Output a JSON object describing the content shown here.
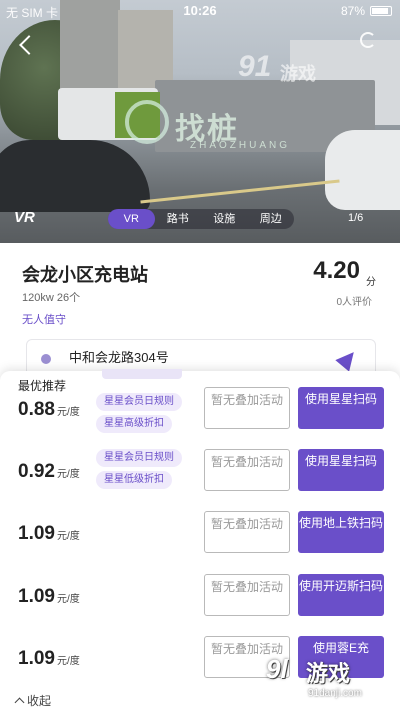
{
  "status_bar": {
    "carrier": "无 SIM 卡",
    "time": "10:26",
    "battery": "87%"
  },
  "hero": {
    "vr_logo": "VR",
    "tabs": [
      {
        "label": "VR",
        "active": true
      },
      {
        "label": "路书",
        "active": false
      },
      {
        "label": "设施",
        "active": false
      },
      {
        "label": "周边",
        "active": false
      }
    ],
    "pager": "1/6",
    "watermark": {
      "main": "找桩",
      "sub": "ZHAOZHUANG",
      "site": "91",
      "site_text": "游戏"
    }
  },
  "station": {
    "name": "会龙小区充电站",
    "meta": "120kw 26个",
    "tag": "无人值守",
    "score": "4.20",
    "score_unit": "分",
    "reviews": "0人评价",
    "address": "中和会龙路304号"
  },
  "sheet": {
    "title": "最优推荐",
    "rows": [
      {
        "price": "0.88",
        "unit": "元/度",
        "tags": [
          "星星会员日规则",
          "星星高级折扣"
        ],
        "none_label": "暂无叠加活动",
        "use_label": "使用星星扫码"
      },
      {
        "price": "0.92",
        "unit": "元/度",
        "tags": [
          "星星会员日规则",
          "星星低级折扣"
        ],
        "none_label": "暂无叠加活动",
        "use_label": "使用星星扫码"
      },
      {
        "price": "1.09",
        "unit": "元/度",
        "tags": [],
        "none_label": "暂无叠加活动",
        "use_label": "使用地上铁扫码"
      },
      {
        "price": "1.09",
        "unit": "元/度",
        "tags": [],
        "none_label": "暂无叠加活动",
        "use_label": "使用开迈斯扫码"
      },
      {
        "price": "1.09",
        "unit": "元/度",
        "tags": [],
        "none_label": "暂无叠加活动",
        "use_label": "使用蓉E充"
      }
    ],
    "collapse_label": "收起"
  },
  "corner_watermark": {
    "logo": "9l",
    "text": "游戏",
    "url": "91danji.com"
  },
  "colors": {
    "accent": "#6a4fc9",
    "tag_bg": "#efeafb"
  }
}
